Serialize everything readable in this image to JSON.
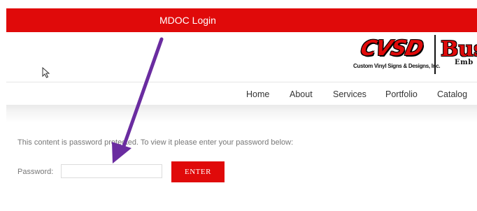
{
  "topbar": {
    "title": "MDOC Login",
    "color": "#e00a0a"
  },
  "logos": {
    "cvsd": {
      "wordmark": "CVSD",
      "tagline": "Custom Vinyl Signs & Designs, Inc."
    },
    "bee": {
      "wordmark": "Bus",
      "sub": "Emb"
    }
  },
  "nav": {
    "items": [
      {
        "label": "Home"
      },
      {
        "label": "About"
      },
      {
        "label": "Services"
      },
      {
        "label": "Portfolio"
      },
      {
        "label": "Catalog"
      }
    ]
  },
  "content": {
    "notice": "This content is password protected. To view it please enter your password below:",
    "password_label": "Password:",
    "password_value": "",
    "enter_label": "ENTER"
  },
  "annotation": {
    "arrow_color": "#6a2ca0"
  },
  "icons": {
    "cursor": "mouse-pointer-icon",
    "arrow": "annotation-arrow-icon"
  }
}
